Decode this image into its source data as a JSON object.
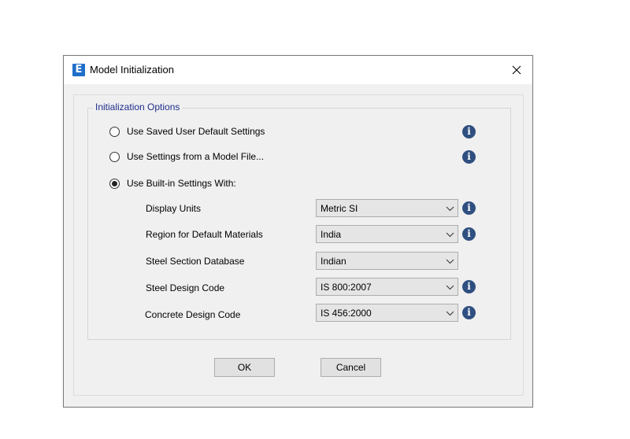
{
  "window": {
    "title": "Model Initialization",
    "app_icon_letter": "E",
    "close_icon": "close-icon"
  },
  "group": {
    "legend": "Initialization Options"
  },
  "options": [
    {
      "label": "Use Saved User Default Settings",
      "checked": false,
      "has_info": true
    },
    {
      "label": "Use Settings from a Model File...",
      "checked": false,
      "has_info": true
    },
    {
      "label": "Use Built-in Settings With:",
      "checked": true,
      "has_info": false
    }
  ],
  "fields": [
    {
      "label": "Display Units",
      "value": "Metric SI",
      "has_info": true
    },
    {
      "label": "Region for Default Materials",
      "value": "India",
      "has_info": true
    },
    {
      "label": "Steel Section Database",
      "value": "Indian",
      "has_info": false
    },
    {
      "label": "Steel Design Code",
      "value": "IS 800:2007",
      "has_info": true
    },
    {
      "label": "Concrete Design Code",
      "value": "IS 456:2000",
      "has_info": true
    }
  ],
  "info_glyph": "i",
  "buttons": {
    "ok": "OK",
    "cancel": "Cancel"
  },
  "colors": {
    "app_icon": "#1f6fc9",
    "legend_text": "#1e2d8c",
    "info_icon": "#2f4f80"
  }
}
